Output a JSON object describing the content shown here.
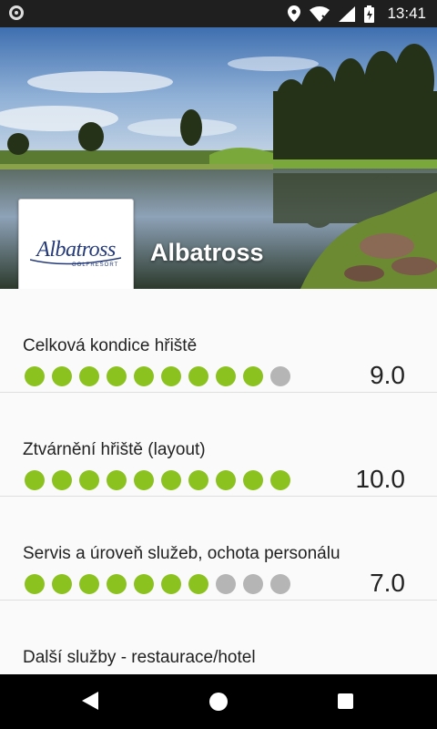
{
  "status_bar": {
    "time": "13:41",
    "icons": [
      "app-notification-icon",
      "location-icon",
      "wifi-icon",
      "signal-icon",
      "battery-icon"
    ]
  },
  "header": {
    "logo_text": "Albatross",
    "logo_subtext": "GOLFRESORT",
    "title": "Albatross"
  },
  "ratings": [
    {
      "label": "Celková kondice hřiště",
      "score": "9.0",
      "value": 9,
      "max": 10
    },
    {
      "label": "Ztvárnění hřiště (layout)",
      "score": "10.0",
      "value": 10,
      "max": 10
    },
    {
      "label": "Servis a úroveň služeb, ochota personálu",
      "score": "7.0",
      "value": 7,
      "max": 10
    }
  ],
  "partial_rating": {
    "label": "Další služby - restaurace/hotel"
  },
  "colors": {
    "dot_on": "#8cc220",
    "dot_off": "#b5b5b5"
  },
  "nav_bar": {
    "icons": [
      "back-icon",
      "home-icon",
      "recents-icon"
    ]
  }
}
